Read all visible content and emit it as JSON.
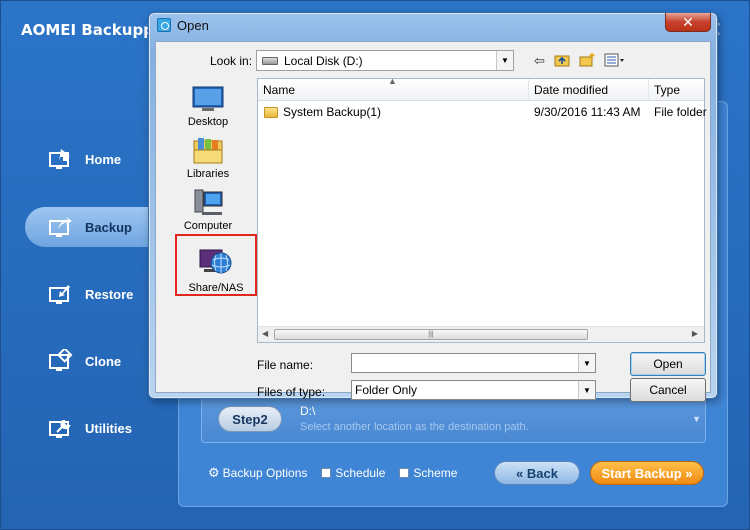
{
  "app": {
    "title": "AOMEI Backupper",
    "close_glyph": "✕",
    "nav": [
      {
        "label": "Home",
        "icon": "home-icon"
      },
      {
        "label": "Backup",
        "icon": "backup-icon",
        "active": true
      },
      {
        "label": "Restore",
        "icon": "restore-icon"
      },
      {
        "label": "Clone",
        "icon": "clone-icon"
      },
      {
        "label": "Utilities",
        "icon": "utilities-icon"
      }
    ],
    "step2": {
      "label": "Step2",
      "path": "D:\\",
      "hint": "Select another location as the destination path."
    },
    "footer": {
      "backup_options": "Backup Options",
      "schedule": "Schedule",
      "scheme": "Scheme",
      "back": "« Back",
      "start": "Start Backup »"
    },
    "colors": {
      "accent": "#2b74c8",
      "start_button": "#f08a10"
    }
  },
  "dialog": {
    "title": "Open",
    "close_glyph": "✕",
    "look_in_label": "Look in:",
    "look_in_value": "Local Disk (D:)",
    "places": [
      {
        "label": "Desktop",
        "icon": "desktop-icon"
      },
      {
        "label": "Libraries",
        "icon": "libraries-icon"
      },
      {
        "label": "Computer",
        "icon": "computer-icon"
      },
      {
        "label": "Share/NAS",
        "icon": "network-globe-icon"
      }
    ],
    "columns": [
      "Name",
      "Date modified",
      "Type"
    ],
    "rows": [
      {
        "name": "System Backup(1)",
        "date": "9/30/2016 11:43 AM",
        "type": "File folder"
      }
    ],
    "file_name_label": "File name:",
    "file_name_value": "",
    "files_of_type_label": "Files of type:",
    "files_of_type_value": "Folder Only",
    "open_label": "Open",
    "cancel_label": "Cancel",
    "highlight_color": "#e0281e"
  }
}
